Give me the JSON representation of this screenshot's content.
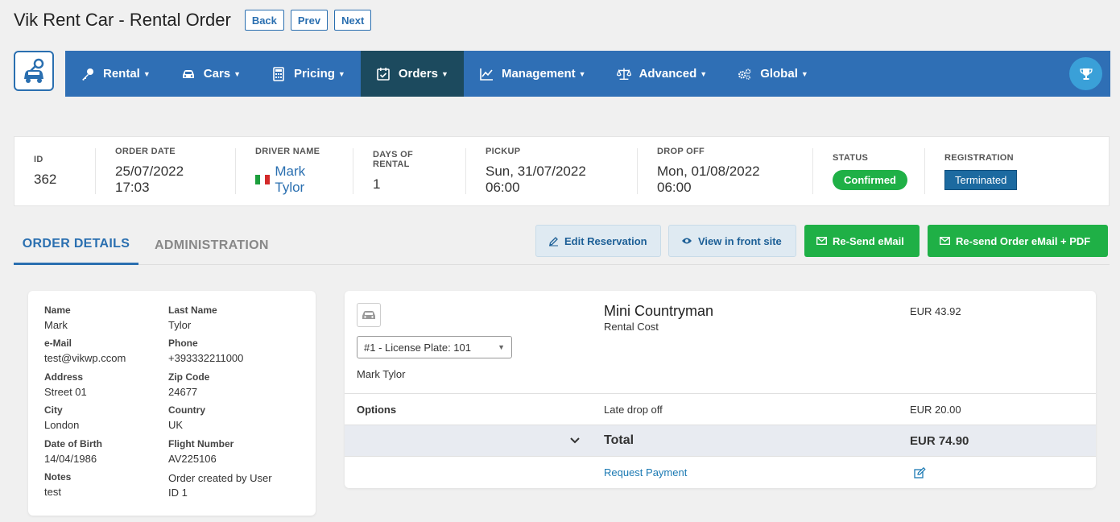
{
  "header": {
    "title": "Vik Rent Car - Rental Order",
    "back_label": "Back",
    "prev_label": "Prev",
    "next_label": "Next"
  },
  "menu": {
    "items": [
      {
        "label": "Rental",
        "icon": "key-icon"
      },
      {
        "label": "Cars",
        "icon": "car-icon"
      },
      {
        "label": "Pricing",
        "icon": "calculator-icon"
      },
      {
        "label": "Orders",
        "icon": "calendar-check-icon",
        "active": true
      },
      {
        "label": "Management",
        "icon": "chart-line-icon"
      },
      {
        "label": "Advanced",
        "icon": "balance-scale-icon"
      },
      {
        "label": "Global",
        "icon": "cogs-icon"
      }
    ],
    "trophy_icon": "trophy-icon"
  },
  "summary": {
    "id_label": "ID",
    "id_value": "362",
    "order_date_label": "ORDER DATE",
    "order_date_value": "25/07/2022 17:03",
    "driver_label": "DRIVER NAME",
    "driver_value": "Mark Tylor",
    "days_label": "DAYS OF RENTAL",
    "days_value": "1",
    "pickup_label": "PICKUP",
    "pickup_value": "Sun, 31/07/2022 06:00",
    "dropoff_label": "DROP OFF",
    "dropoff_value": "Mon, 01/08/2022 06:00",
    "status_label": "STATUS",
    "status_value": "Confirmed",
    "registration_label": "REGISTRATION",
    "registration_value": "Terminated"
  },
  "tabs": {
    "order_details": "ORDER DETAILS",
    "administration": "ADMINISTRATION"
  },
  "actions": {
    "edit": "Edit Reservation",
    "view": "View in front site",
    "resend": "Re-Send eMail",
    "resend_pdf": "Re-send Order eMail + PDF"
  },
  "customer": {
    "name_label": "Name",
    "name": "Mark",
    "lastname_label": "Last Name",
    "lastname": "Tylor",
    "email_label": "e-Mail",
    "email": "test@vikwp.ccom",
    "phone_label": "Phone",
    "phone": "+393332211000",
    "address_label": "Address",
    "address": "Street 01",
    "zip_label": "Zip Code",
    "zip": "24677",
    "city_label": "City",
    "city": "London",
    "country_label": "Country",
    "country": "UK",
    "dob_label": "Date of Birth",
    "dob": "14/04/1986",
    "flight_label": "Flight Number",
    "flight": "AV225106",
    "notes_label": "Notes",
    "notes": "test",
    "created_line1": "Order created by User",
    "created_line2": "ID 1"
  },
  "car": {
    "name": "Mini Countryman",
    "sub": "Rental Cost",
    "price": "EUR 43.92",
    "plate_option": "#1 - License Plate: 101",
    "driver": "Mark Tylor",
    "options_label": "Options",
    "option_name": "Late drop off",
    "option_price": "EUR 20.00",
    "total_label": "Total",
    "total_value": "EUR 74.90",
    "request_payment": "Request Payment"
  },
  "colors": {
    "menu_bg": "#2f6fb5",
    "menu_active": "#1c4a5e",
    "green": "#1fb046",
    "link": "#2a6fb0"
  }
}
